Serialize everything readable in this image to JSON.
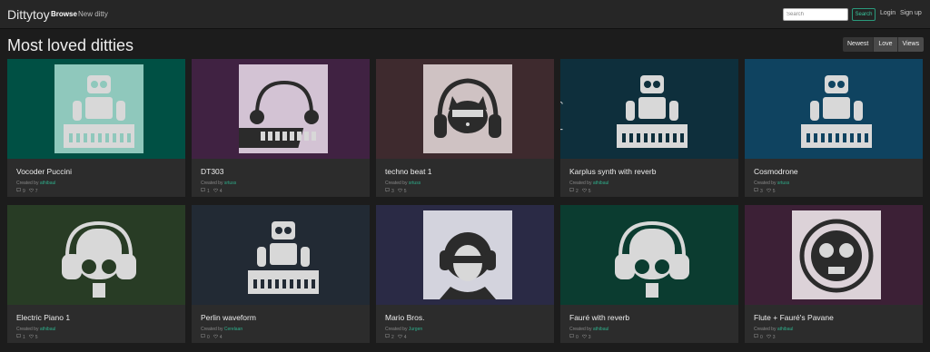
{
  "nav": {
    "brand": "Dittytoy",
    "browse": "Browse",
    "new_ditty": "New ditty",
    "search_placeholder": "Search",
    "search_button": "Search",
    "login": "Login",
    "signup": "Sign up"
  },
  "page": {
    "title": "Most loved ditties",
    "sort": [
      "Newest",
      "Love",
      "Views"
    ],
    "created_by": "Created by "
  },
  "cards": [
    {
      "title": "Vocoder Puccini",
      "author": "athibaul",
      "comments": "9",
      "loves": "7",
      "bg": "#005044",
      "art_bg": "#8fc8bc",
      "icon": "robot-dj-icon"
    },
    {
      "title": "DT303",
      "author": "srtuss",
      "comments": "1",
      "loves": "4",
      "bg": "#402242",
      "art_bg": "#d3c3d4",
      "icon": "synthesizer-icon"
    },
    {
      "title": "techno beat 1",
      "author": "srtuss",
      "comments": "3",
      "loves": "5",
      "bg": "#3e2a2e",
      "art_bg": "#cfc2c3",
      "icon": "cat-headphones-icon"
    },
    {
      "title": "Karplus synth with reverb",
      "author": "athibaul",
      "comments": "2",
      "loves": "5",
      "bg": "#0e2f3c",
      "art_bg": "#0e2f3c",
      "icon": "robot-dj-icon"
    },
    {
      "title": "Cosmodrone",
      "author": "srtuss",
      "comments": "3",
      "loves": "5",
      "bg": "#0f4360",
      "art_bg": "#0f4360",
      "icon": "robot-dj-icon"
    },
    {
      "title": "Electric Piano 1",
      "author": "athibaul",
      "comments": "1",
      "loves": "5",
      "bg": "#283c25",
      "art_bg": "#283c25",
      "icon": "robot-headphones-icon"
    },
    {
      "title": "Perlin waveform",
      "author": "Cerelaan",
      "comments": "0",
      "loves": "4",
      "bg": "#222a34",
      "art_bg": "#222a34",
      "icon": "robot-dj-icon"
    },
    {
      "title": "Mario Bros.",
      "author": "Jurgen",
      "comments": "2",
      "loves": "4",
      "bg": "#2a2a45",
      "art_bg": "#d3d3dd",
      "icon": "headphones-person-icon"
    },
    {
      "title": "Fauré with reverb",
      "author": "athibaul",
      "comments": "0",
      "loves": "3",
      "bg": "#0b3c30",
      "art_bg": "#0b3c30",
      "icon": "robot-headphones-icon"
    },
    {
      "title": "Flute + Fauré's Pavane",
      "author": "athibaul",
      "comments": "0",
      "loves": "3",
      "bg": "#3c2036",
      "art_bg": "#dcd2d8",
      "icon": "astronaut-icon"
    }
  ]
}
